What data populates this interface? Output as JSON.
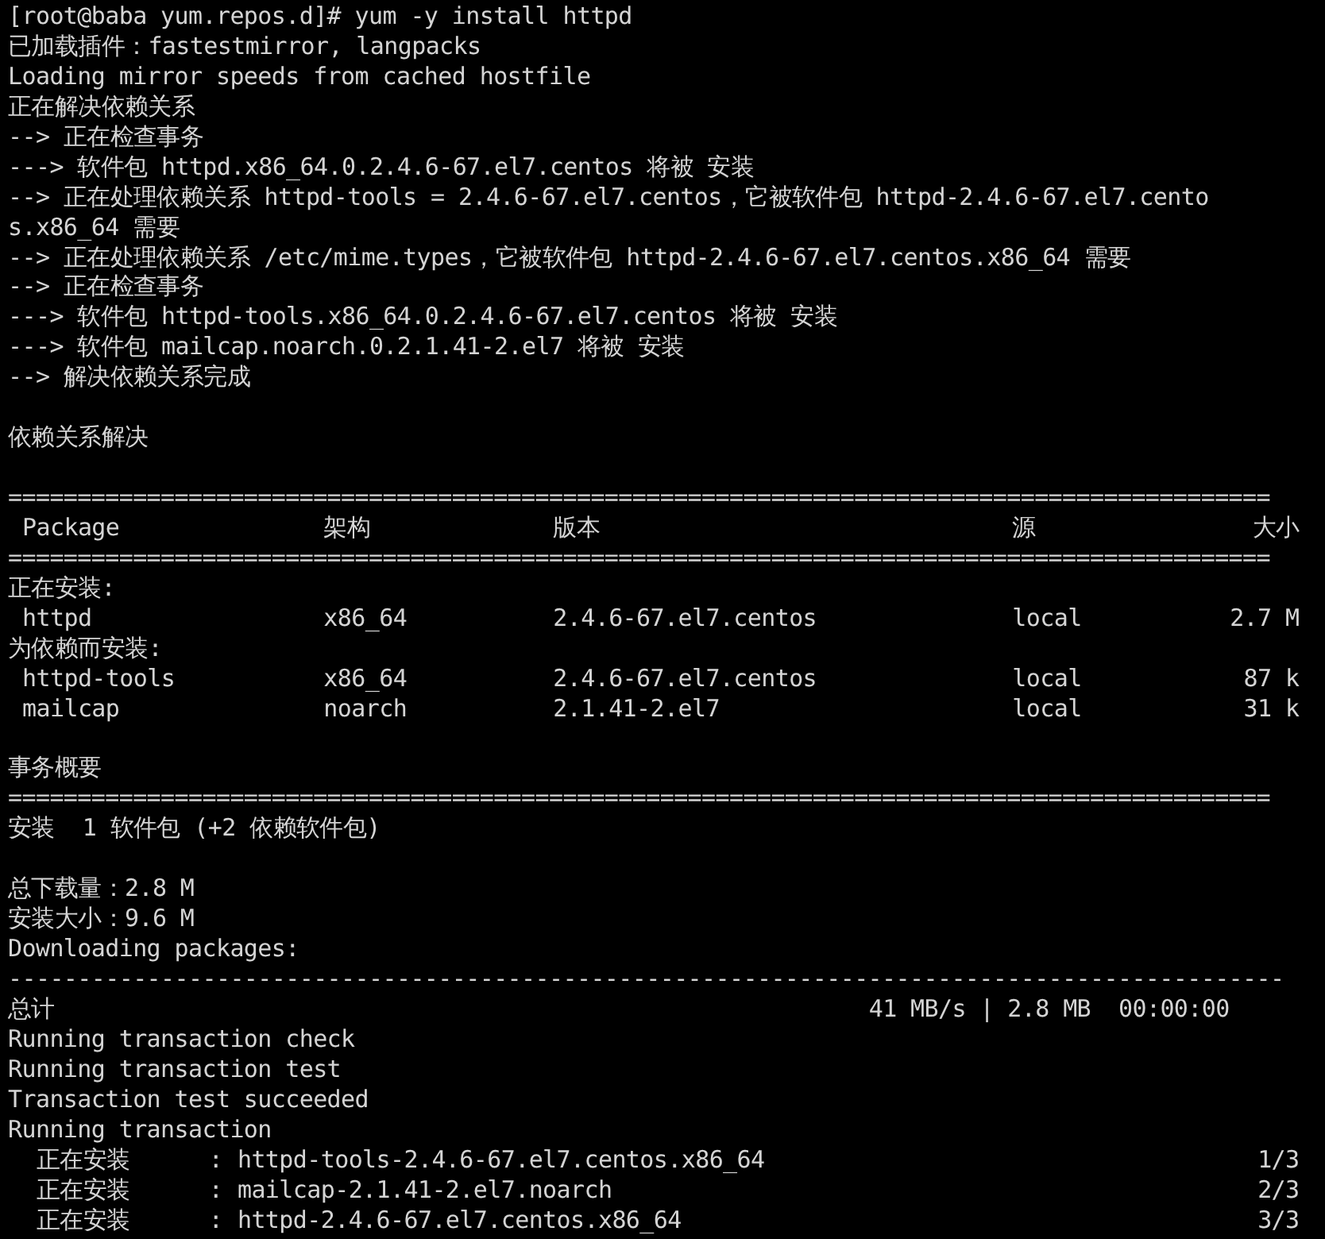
{
  "terminal": {
    "lines": [
      {
        "kind": "text",
        "text": "[root@baba yum.repos.d]# yum -y install httpd"
      },
      {
        "kind": "text",
        "text": "已加载插件：fastestmirror, langpacks"
      },
      {
        "kind": "text",
        "text": "Loading mirror speeds from cached hostfile"
      },
      {
        "kind": "text",
        "text": "正在解决依赖关系"
      },
      {
        "kind": "text",
        "text": "--> 正在检查事务"
      },
      {
        "kind": "text",
        "text": "---> 软件包 httpd.x86_64.0.2.4.6-67.el7.centos 将被 安装"
      },
      {
        "kind": "text",
        "text": "--> 正在处理依赖关系 httpd-tools = 2.4.6-67.el7.centos，它被软件包 httpd-2.4.6-67.el7.cento"
      },
      {
        "kind": "text",
        "text": "s.x86_64 需要"
      },
      {
        "kind": "text",
        "text": "--> 正在处理依赖关系 /etc/mime.types，它被软件包 httpd-2.4.6-67.el7.centos.x86_64 需要"
      },
      {
        "kind": "text",
        "text": "--> 正在检查事务"
      },
      {
        "kind": "text",
        "text": "---> 软件包 httpd-tools.x86_64.0.2.4.6-67.el7.centos 将被 安装"
      },
      {
        "kind": "text",
        "text": "---> 软件包 mailcap.noarch.0.2.1.41-2.el7 将被 安装"
      },
      {
        "kind": "text",
        "text": "--> 解决依赖关系完成"
      },
      {
        "kind": "blank"
      },
      {
        "kind": "text",
        "text": "依赖关系解决"
      },
      {
        "kind": "blank"
      },
      {
        "kind": "rule",
        "text": "==========================================================================================="
      },
      {
        "kind": "header",
        "cells": [
          "Package",
          "架构",
          "版本",
          "源",
          "大小"
        ]
      },
      {
        "kind": "rule",
        "text": "==========================================================================================="
      },
      {
        "kind": "text",
        "text": "正在安装:"
      },
      {
        "kind": "table",
        "cells": [
          "httpd",
          "x86_64",
          "2.4.6-67.el7.centos",
          "local",
          "2.7 M"
        ]
      },
      {
        "kind": "text",
        "text": "为依赖而安装:"
      },
      {
        "kind": "table",
        "cells": [
          "httpd-tools",
          "x86_64",
          "2.4.6-67.el7.centos",
          "local",
          "87 k"
        ]
      },
      {
        "kind": "table",
        "cells": [
          "mailcap",
          "noarch",
          "2.1.41-2.el7",
          "local",
          "31 k"
        ]
      },
      {
        "kind": "blank"
      },
      {
        "kind": "text",
        "text": "事务概要"
      },
      {
        "kind": "rule",
        "text": "==========================================================================================="
      },
      {
        "kind": "text",
        "text": "安装  1 软件包 (+2 依赖软件包)"
      },
      {
        "kind": "blank"
      },
      {
        "kind": "text",
        "text": "总下载量：2.8 M"
      },
      {
        "kind": "text",
        "text": "安装大小：9.6 M"
      },
      {
        "kind": "text",
        "text": "Downloading packages:"
      },
      {
        "kind": "rule",
        "text": "--------------------------------------------------------------------------------------------"
      },
      {
        "kind": "total",
        "cells": [
          "总计",
          "41 MB/s | 2.8 MB  00:00:00"
        ]
      },
      {
        "kind": "text",
        "text": "Running transaction check"
      },
      {
        "kind": "text",
        "text": "Running transaction test"
      },
      {
        "kind": "text",
        "text": "Transaction test succeeded"
      },
      {
        "kind": "text",
        "text": "Running transaction"
      },
      {
        "kind": "progress",
        "cells": [
          "正在安装",
          ":",
          "httpd-tools-2.4.6-67.el7.centos.x86_64",
          "1/3"
        ]
      },
      {
        "kind": "progress",
        "cells": [
          "正在安装",
          ":",
          "mailcap-2.1.41-2.el7.noarch",
          "2/3"
        ]
      },
      {
        "kind": "progress",
        "cells": [
          "正在安装",
          ":",
          "httpd-2.4.6-67.el7.centos.x86_64",
          "3/3"
        ]
      }
    ]
  }
}
